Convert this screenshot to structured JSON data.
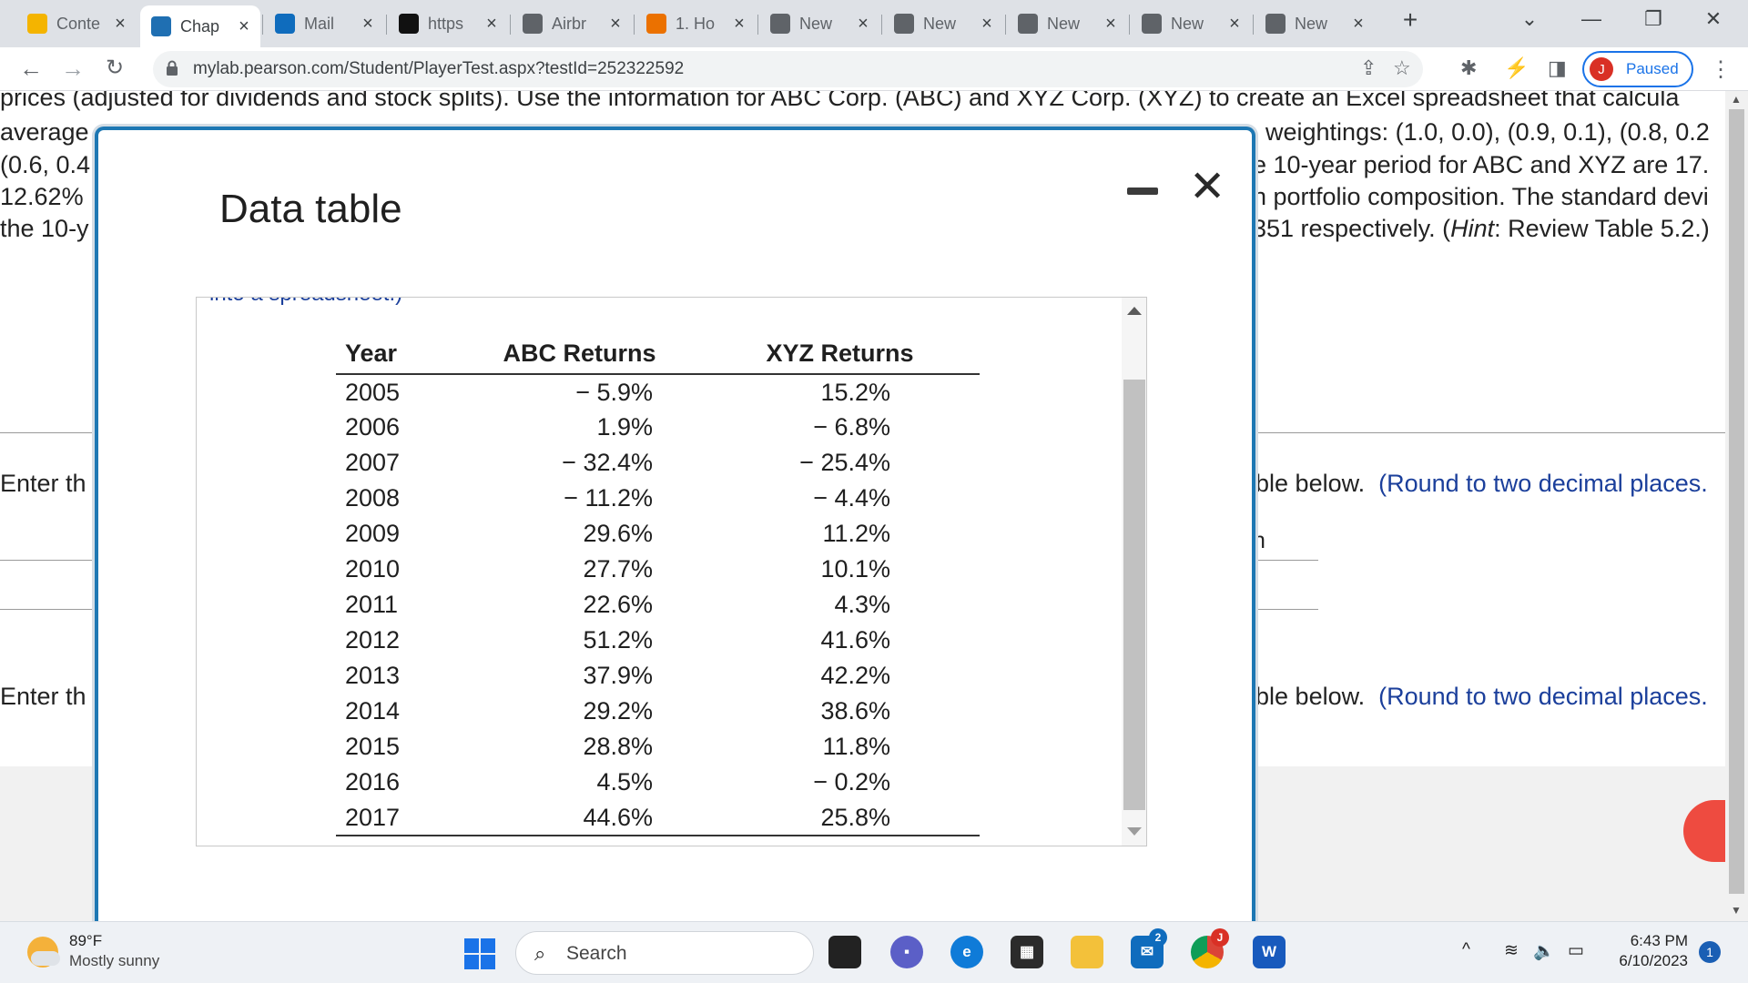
{
  "browser": {
    "tabs": [
      {
        "label": "Conte",
        "icon": "pencil-icon",
        "color": "#f4b400"
      },
      {
        "label": "Chap",
        "icon": "pearson-icon",
        "color": "#1f6fb2"
      },
      {
        "label": "Mail",
        "icon": "outlook-icon",
        "color": "#0f6cbd"
      },
      {
        "label": "https",
        "icon": "blackboard-icon",
        "color": "#111111"
      },
      {
        "label": "Airbr",
        "icon": "chatgpt-icon",
        "color": "#5f6368"
      },
      {
        "label": "1. Ho",
        "icon": "chegg-icon",
        "color": "#eb7100"
      },
      {
        "label": "New",
        "icon": "chatgpt-icon",
        "color": "#5f6368"
      },
      {
        "label": "New",
        "icon": "chatgpt-icon",
        "color": "#5f6368"
      },
      {
        "label": "New",
        "icon": "chatgpt-icon",
        "color": "#5f6368"
      },
      {
        "label": "New",
        "icon": "chatgpt-icon",
        "color": "#5f6368"
      },
      {
        "label": "New",
        "icon": "chatgpt-icon",
        "color": "#5f6368"
      }
    ],
    "url": "mylab.pearson.com/Student/PlayerTest.aspx?testId=252322592",
    "profile_initial": "J",
    "profile_label": "Paused"
  },
  "page": {
    "question_lines": {
      "l1": "prices (adjusted for dividends and stock splits). Use the information for ABC Corp. (ABC) and XYZ Corp. (XYZ) to create an Excel spreadsheet that calcula",
      "l2_left": "average",
      "l2_right": ", weightings: (1.0, 0.0), (0.9, 0.1), (0.8, 0.2",
      "l3_left": "(0.6, 0.4",
      "l3_right": "e 10-year period for ABC and XYZ are 17.",
      "l4_left": "12.62%",
      "l4_right": "n portfolio composition. The standard devi",
      "l5_left": "the 10-y",
      "l5_right_a": "351 respectively. (",
      "l5_hint": "Hint",
      "l5_right_b": ": Review Table 5.2.)"
    },
    "enter1_left": "Enter th",
    "enter1_right": "able below.",
    "enter1_round": "(Round to two decimal places.",
    "frag_n": "n",
    "enter2_left": "Enter th",
    "enter2_right": "able below.",
    "enter2_round": "(Round to two decimal places."
  },
  "modal": {
    "title": "Data table",
    "cut_text": "into a spreadsheet.)",
    "headers": [
      "Year",
      "ABC Returns",
      "XYZ Returns"
    ],
    "rows": [
      [
        "2005",
        "− 5.9%",
        "15.2%"
      ],
      [
        "2006",
        "1.9%",
        "− 6.8%"
      ],
      [
        "2007",
        "− 32.4%",
        "− 25.4%"
      ],
      [
        "2008",
        "− 11.2%",
        "− 4.4%"
      ],
      [
        "2009",
        "29.6%",
        "11.2%"
      ],
      [
        "2010",
        "27.7%",
        "10.1%"
      ],
      [
        "2011",
        "22.6%",
        "4.3%"
      ],
      [
        "2012",
        "51.2%",
        "41.6%"
      ],
      [
        "2013",
        "37.9%",
        "42.2%"
      ],
      [
        "2014",
        "29.2%",
        "38.6%"
      ],
      [
        "2015",
        "28.8%",
        "11.8%"
      ],
      [
        "2016",
        "4.5%",
        "− 0.2%"
      ],
      [
        "2017",
        "44.6%",
        "25.8%"
      ]
    ]
  },
  "taskbar": {
    "temperature": "89°F",
    "condition": "Mostly sunny",
    "search_label": "Search",
    "mail_badge": "2",
    "chrome_badge": "J",
    "time": "6:43 PM",
    "date": "6/10/2023",
    "notification_count": "1"
  }
}
